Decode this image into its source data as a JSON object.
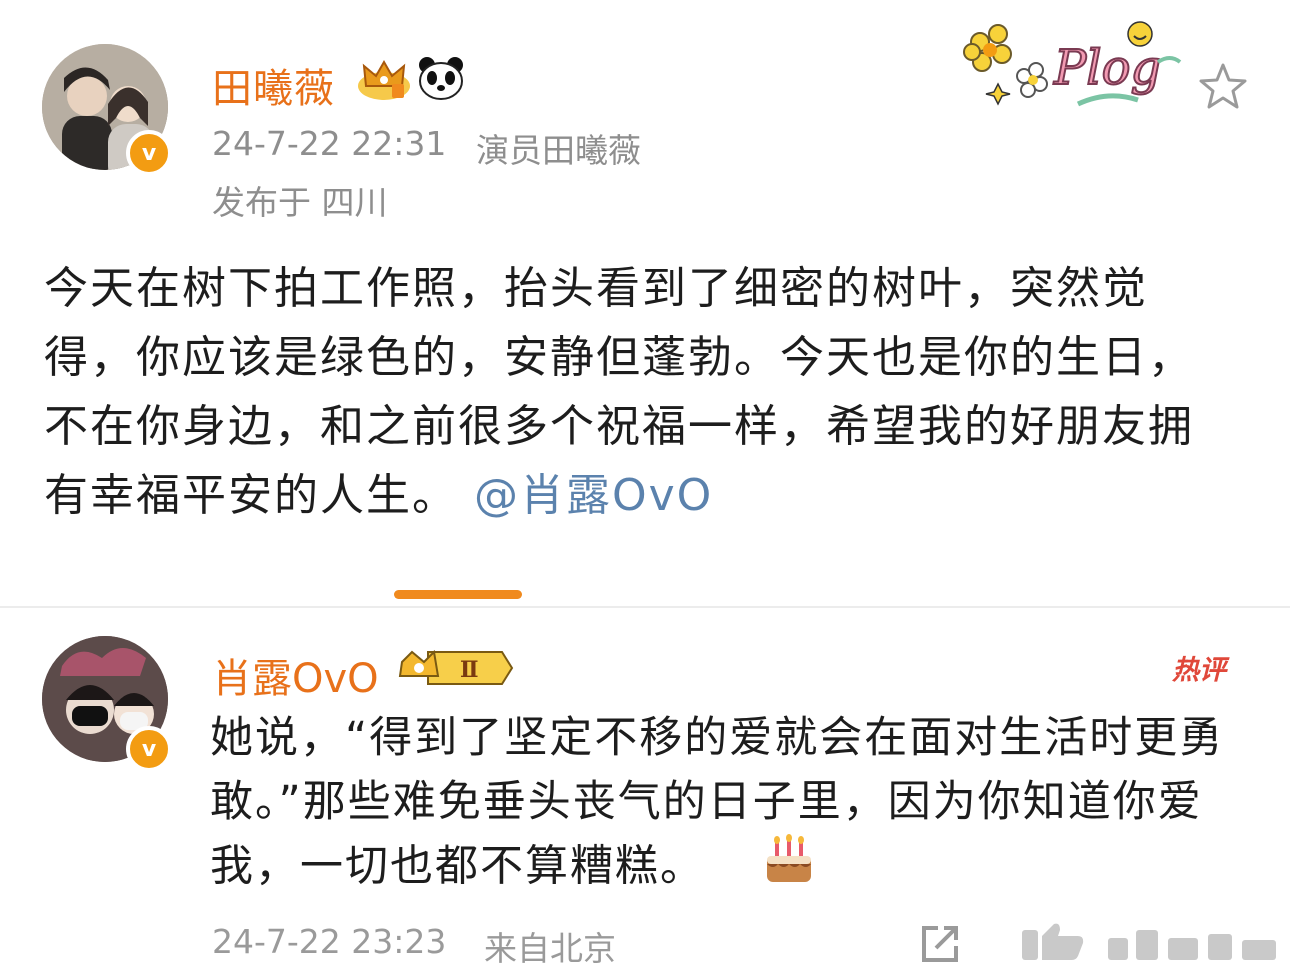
{
  "post": {
    "author": "田曦薇",
    "time": "24-7-22 22:31",
    "source": "演员田曦薇",
    "location": "发布于 四川",
    "text": "今天在树下拍工作照，抬头看到了细密的树叶，突然觉得，你应该是绿色的，安静但蓬勃。今天也是你的生日，不在你身边，和之前很多个祝福一样，希望我的好朋友拥有幸福平安的人生。",
    "mention": "@肖露OvO",
    "sticker_text": "Plog"
  },
  "comment": {
    "author": "肖露OvO",
    "badge": "Ⅱ",
    "hot_label": "热评",
    "text": "她说，“得到了坚定不移的爱就会在面对生活时更勇敢。”那些难免垂头丧气的日子里，因为你知道你爱我，一切也都不算糟糕。",
    "time": "24-7-22 23:23",
    "source": "来自北京"
  },
  "icons": {
    "verified": "v",
    "panda": "panda-icon",
    "crown": "crown-icon",
    "star": "star-icon",
    "cake": "cake-icon",
    "share": "share-icon",
    "like": "like-icon"
  },
  "colors": {
    "name": "#e8711a",
    "mention": "#5b82ad",
    "indicator": "#f08a1e",
    "hot": "#e0483a"
  }
}
